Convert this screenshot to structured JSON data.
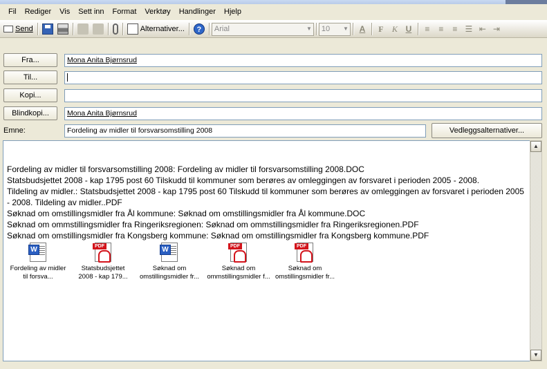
{
  "menu": [
    "Fil",
    "Rediger",
    "Vis",
    "Sett inn",
    "Format",
    "Verktøy",
    "Handlinger",
    "Hjelp"
  ],
  "toolbar": {
    "send_label": "Send",
    "options_label": "Alternativer...",
    "font": "Arial",
    "size": "10",
    "format_buttons": [
      "A",
      "F",
      "K",
      "U"
    ]
  },
  "fields": {
    "from_label": "Fra...",
    "from_value": "Mona Anita Bjørnsrud",
    "to_label": "Til...",
    "to_value": "",
    "cc_label": "Kopi...",
    "cc_value": "",
    "bcc_label": "Blindkopi...",
    "bcc_value": "Mona Anita Bjørnsrud",
    "subject_label": "Emne:",
    "subject_value": "Fordeling av midler til forsvarsomstilling 2008",
    "attach_options_label": "Vedleggsalternativer..."
  },
  "body": {
    "lines": [
      "Fordeling av midler til forsvarsomstilling 2008: Fordeling av midler til forsvarsomstilling 2008.DOC",
      "Statsbudsjettet 2008 - kap 1795 post 60 Tilskudd til kommuner som berøres av omleggingen av forsvaret i perioden 2005 - 2008.",
      "Tildeling av midler.: Statsbudsjettet 2008 - kap 1795 post 60 Tilskudd til kommuner som berøres av omleggingen av forsvaret i perioden 2005 - 2008. Tildeling av midler..PDF",
      "Søknad om omstillingsmidler fra Ål kommune: Søknad om omstillingsmidler fra Ål kommune.DOC",
      "Søknad om ommstillingsmidler fra Ringeriksregionen: Søknad om ommstillingsmidler fra Ringeriksregionen.PDF",
      "Søknad om omstillingsmidler fra Kongsberg kommune: Søknad om omstillingsmidler fra Kongsberg kommune.PDF"
    ]
  },
  "attachments": [
    {
      "type": "word",
      "line1": "Fordeling av midler",
      "line2": "til forsva..."
    },
    {
      "type": "pdf",
      "line1": "Statsbudsjettet",
      "line2": "2008 - kap 179..."
    },
    {
      "type": "word",
      "line1": "Søknad om",
      "line2": "omstillingsmidler fr..."
    },
    {
      "type": "pdf",
      "line1": "Søknad om",
      "line2": "ommstillingsmidler f..."
    },
    {
      "type": "pdf",
      "line1": "Søknad om",
      "line2": "omstillingsmidler fr..."
    }
  ]
}
